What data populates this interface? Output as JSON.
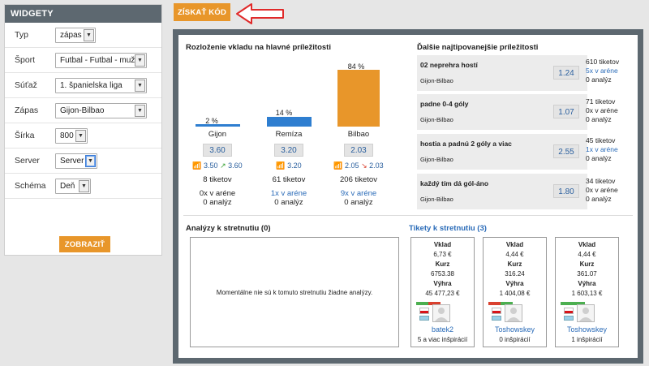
{
  "sidebar": {
    "title": "WIDGETY",
    "rows": [
      {
        "label": "Typ",
        "value": "zápas"
      },
      {
        "label": "Šport",
        "value": "Futbal - Futbal - muži"
      },
      {
        "label": "Súťaž",
        "value": "1. španielska liga"
      },
      {
        "label": "Zápas",
        "value": "Gijon-Bilbao"
      },
      {
        "label": "Šírka",
        "value": "800"
      },
      {
        "label": "Server",
        "value": "Server"
      },
      {
        "label": "Schéma",
        "value": "Deň"
      }
    ],
    "show_label": "ZOBRAZIŤ"
  },
  "toolbar": {
    "code_label": "ZÍSKAŤ KÓD"
  },
  "distribution": {
    "title": "Rozloženie vkladu na hlavné príležitosti",
    "outcomes": [
      {
        "name": "Gijon",
        "pct": "2 %",
        "share": 2,
        "odd": "3.60",
        "trend_old": "3.50",
        "trend_new": "3.60",
        "tickets": "8 tiketov",
        "arena": "0x v aréne",
        "analyses": "0 analýz"
      },
      {
        "name": "Remíza",
        "pct": "14 %",
        "share": 14,
        "odd": "3.20",
        "trend_old": "3.20",
        "trend_new": "",
        "tickets": "61 tiketov",
        "arena": "1x v aréne",
        "analyses": "0 analýz"
      },
      {
        "name": "Bilbao",
        "pct": "84 %",
        "share": 84,
        "odd": "2.03",
        "trend_old": "2.05",
        "trend_new": "2.03",
        "tickets": "206 tiketov",
        "arena": "9x v aréne",
        "analyses": "0 analýz"
      }
    ]
  },
  "other_bets": {
    "title": "Ďalšie najtipovanejšie príležitosti",
    "items": [
      {
        "title": "02 neprehra hostí",
        "match": "Gijon-Bilbao",
        "odd": "1.24",
        "tickets": "610 tiketov",
        "arena": "5x v aréne",
        "analyses": "0 analýz"
      },
      {
        "title": "padne 0-4 góly",
        "match": "Gijon-Bilbao",
        "odd": "1.07",
        "tickets": "71 tiketov",
        "arena": "0x v aréne",
        "analyses": "0 analýz"
      },
      {
        "title": "hostia a padnú 2 góly a viac",
        "match": "Gijon-Bilbao",
        "odd": "2.55",
        "tickets": "45 tiketov",
        "arena": "1x v aréne",
        "analyses": "0 analýz"
      },
      {
        "title": "každý tím dá gól-áno",
        "match": "Gijon-Bilbao",
        "odd": "1.80",
        "tickets": "34 tiketov",
        "arena": "0x v aréne",
        "analyses": "0 analýz"
      }
    ]
  },
  "analyses": {
    "title": "Analýzy k stretnutiu (0)",
    "empty": "Momentálne nie sú k tomuto stretnutiu žiadne analýzy."
  },
  "tickets": {
    "title": "Tikety k stretnutiu (3)",
    "labels": {
      "stake": "Vklad",
      "odds": "Kurz",
      "win": "Výhra"
    },
    "items": [
      {
        "stake": "6,73 €",
        "odds": "6753.38",
        "win": "45 477,23 €",
        "user": "batek2",
        "inspirations": "5 a viac inšpirácií",
        "strip": [
          "#4caf50",
          "#d9412f"
        ]
      },
      {
        "stake": "4,44 €",
        "odds": "316.24",
        "win": "1 404,08 €",
        "user": "Toshowskey",
        "inspirations": "0 inšpirácií",
        "strip": [
          "#d9412f",
          "#4caf50"
        ]
      },
      {
        "stake": "4,44 €",
        "odds": "361.07",
        "win": "1 603,13 €",
        "user": "Toshowskey",
        "inspirations": "1 inšpirácií",
        "strip": [
          "#4caf50",
          "#4caf50"
        ]
      }
    ]
  },
  "colors": {
    "accent": "#e8962a",
    "bar_blue": "#2e7ed0",
    "frame": "#5d6870",
    "link": "#2a6bb8"
  }
}
